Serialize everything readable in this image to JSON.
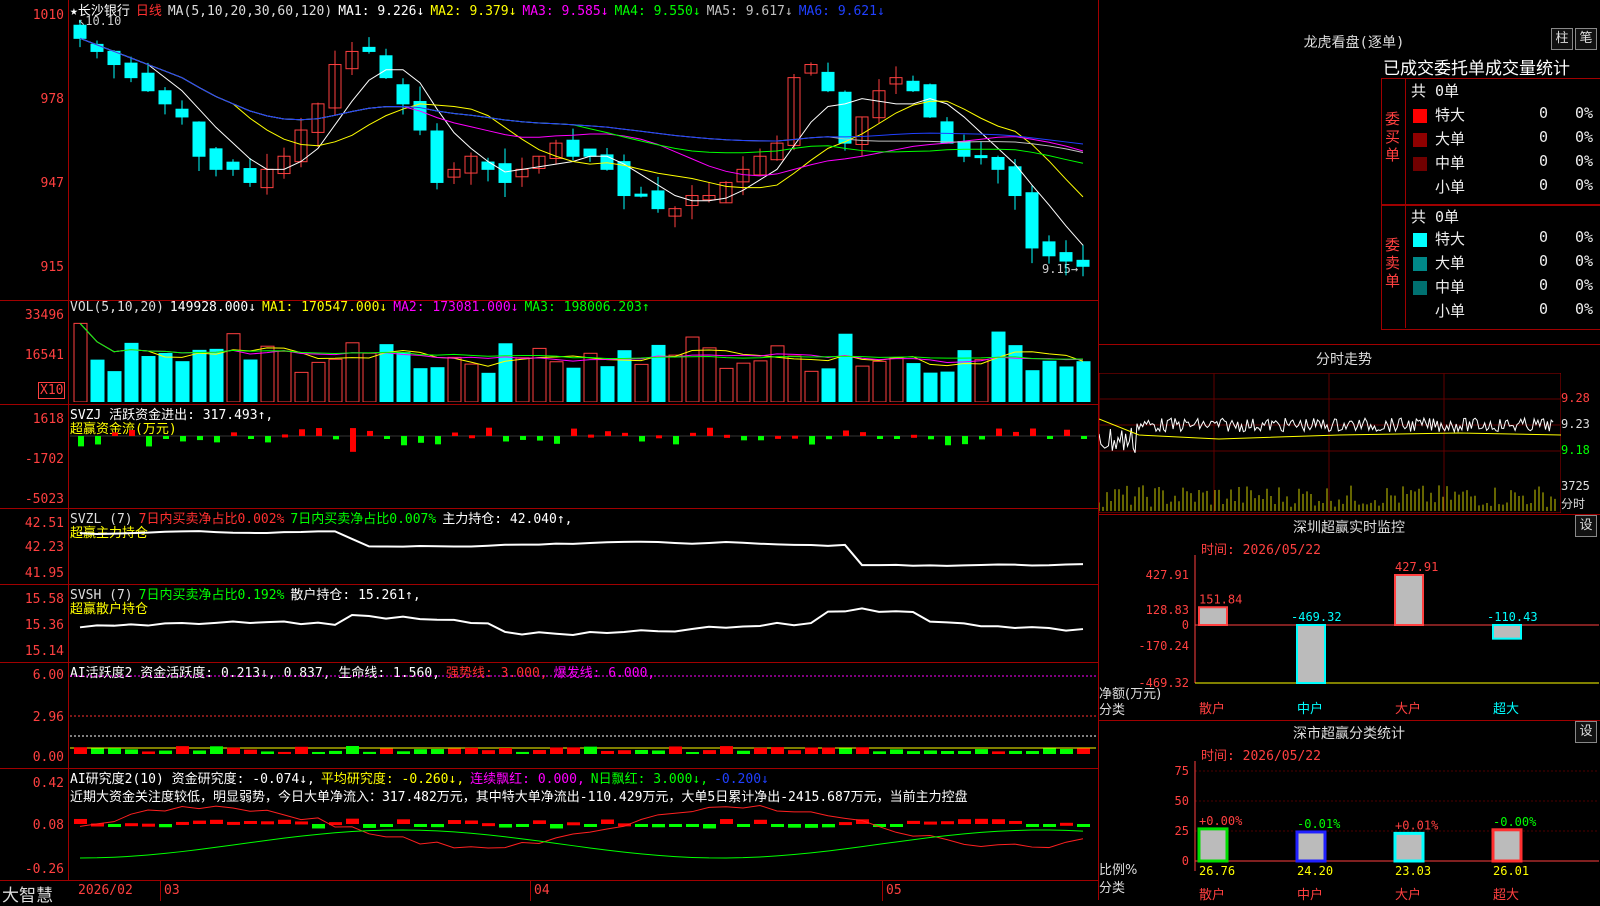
{
  "header": {
    "stock_name": "★长沙银行",
    "period": "日线",
    "ma_params": "MA(5,10,20,30,60,120)",
    "ma": [
      {
        "label": "MA1:",
        "value": "9.226↓",
        "color": "#ffffff"
      },
      {
        "label": "MA2:",
        "value": "9.379↓",
        "color": "#ffff00"
      },
      {
        "label": "MA3:",
        "value": "9.585↓",
        "color": "#ff00ff"
      },
      {
        "label": "MA4:",
        "value": "9.550↓",
        "color": "#00ff00"
      },
      {
        "label": "MA5:",
        "value": "9.617↓",
        "color": "#c0c0c0"
      },
      {
        "label": "MA6:",
        "value": "9.621↓",
        "color": "#2040ff"
      }
    ],
    "high_mark": "10.10",
    "low_mark": "9.15"
  },
  "price_axis": [
    "1010",
    "978",
    "947",
    "915"
  ],
  "vol": {
    "title": "VOL(5,10,20)",
    "value": "149928.000↓",
    "ma1": "MA1: 170547.000↓",
    "ma2": "MA2: 173081.000↓",
    "ma3": "MA3: 198006.203↑",
    "axis": [
      "33496",
      "16541"
    ],
    "unit": "X10"
  },
  "svzj": {
    "title": "SVZJ  活跃资金进出: 317.493↑,",
    "sub": "超赢资金流(万元)",
    "axis": [
      "1618",
      "-1702",
      "-5023"
    ]
  },
  "svzl": {
    "title": "SVZL (7)",
    "t1": "7日内买卖净占比0.002%",
    "t2": "7日内买卖净占比0.007%",
    "t3": "主力持仓: 42.040↑,",
    "sub": "超赢主力持仓",
    "axis": [
      "42.51",
      "42.23",
      "41.95"
    ]
  },
  "svsh": {
    "title": "SVSH (7)",
    "t1": "7日内买卖净占比0.192%",
    "t2": "散户持仓: 15.261↑,",
    "sub": "超赢散户持仓",
    "axis": [
      "15.58",
      "15.36",
      "15.14"
    ]
  },
  "ai1": {
    "title": "AI活跃度2 资金活跃度: 0.213↓, 0.837, 生命线: 1.560,",
    "t1": "强势线: 3.000,",
    "t2": "爆发线: 6.000,",
    "axis": [
      "6.00",
      "2.96",
      "0.00"
    ]
  },
  "ai2": {
    "title": "AI研究度2(10) 资金研究度: -0.074↓,",
    "t1": "平均研究度: -0.260↓,",
    "t2": "连续飘红: 0.000,",
    "t3": "N日飘红: 3.000↓,",
    "t4": "-0.200↓",
    "desc": "近期大资金关注度较低，明显弱势，今日大单净流入：317.482万元，其中特大单净流出-110.429万元，大单5日累计净出-2415.687万元，当前主力控盘",
    "axis": [
      "0.42",
      "0.08",
      "-0.26"
    ]
  },
  "dates": [
    "2026/02",
    "03",
    "04",
    "05"
  ],
  "brand": "大智慧",
  "longhu": {
    "title": "龙虎看盘(逐单)",
    "btn1": "柱",
    "btn2": "笔",
    "subtitle": "已成交委托单成交量统计",
    "buy_label": "委买单",
    "sell_label": "委卖单",
    "buy_total": "共 0单",
    "sell_total": "共 0单",
    "buy_rows": [
      {
        "name": "特大",
        "v": "0",
        "p": "0%",
        "color": "#ff0000"
      },
      {
        "name": "大单",
        "v": "0",
        "p": "0%",
        "color": "#900000"
      },
      {
        "name": "中单",
        "v": "0",
        "p": "0%",
        "color": "#700000"
      },
      {
        "name": "小单",
        "v": "0",
        "p": "0%",
        "color": ""
      }
    ],
    "sell_rows": [
      {
        "name": "特大",
        "v": "0",
        "p": "0%",
        "color": "#00ffff"
      },
      {
        "name": "大单",
        "v": "0",
        "p": "0%",
        "color": "#008888"
      },
      {
        "name": "中单",
        "v": "0",
        "p": "0%",
        "color": "#007070"
      },
      {
        "name": "小单",
        "v": "0",
        "p": "0%",
        "color": ""
      }
    ]
  },
  "intraday": {
    "title": "分时走势",
    "axis": [
      "9.28",
      "9.23",
      "9.18"
    ],
    "vol_value": "3725",
    "vol_label": "分时"
  },
  "monitor": {
    "title": "深圳超赢实时监控",
    "btn": "设",
    "time": "时间: 2026/05/22",
    "axis": [
      "427.91",
      "128.83",
      "0",
      "-170.24",
      "-469.32"
    ],
    "ylabel": "净额(万元)",
    "xlabel": "分类",
    "bars": [
      {
        "cat": "散户",
        "value": 151.84,
        "label": "151.84",
        "color": "#ff4040"
      },
      {
        "cat": "中户",
        "value": -469.32,
        "label": "-469.32",
        "color": "#00ffff"
      },
      {
        "cat": "大户",
        "value": 427.91,
        "label": "427.91",
        "color": "#ff4040"
      },
      {
        "cat": "超大",
        "value": -110.43,
        "label": "-110.43",
        "color": "#00ffff"
      }
    ]
  },
  "classify": {
    "title": "深市超赢分类统计",
    "btn": "设",
    "time": "时间: 2026/05/22",
    "axis": [
      "75",
      "50",
      "25",
      "0"
    ],
    "ylabel": "比例%",
    "xlabel": "分类",
    "bars": [
      {
        "cat": "散户",
        "value": 26.76,
        "label": "26.76",
        "chg": "+0.00%",
        "chg_color": "#ff4040",
        "color": "#00dd00"
      },
      {
        "cat": "中户",
        "value": 24.2,
        "label": "24.20",
        "chg": "-0.01%",
        "chg_color": "#00ff00",
        "color": "#2020ff"
      },
      {
        "cat": "大户",
        "value": 23.03,
        "label": "23.03",
        "chg": "+0.01%",
        "chg_color": "#ff4040",
        "color": "#00ffff"
      },
      {
        "cat": "超大",
        "value": 26.01,
        "label": "26.01",
        "chg": "-0.00%",
        "chg_color": "#00ff00",
        "color": "#ff3030"
      }
    ]
  }
}
